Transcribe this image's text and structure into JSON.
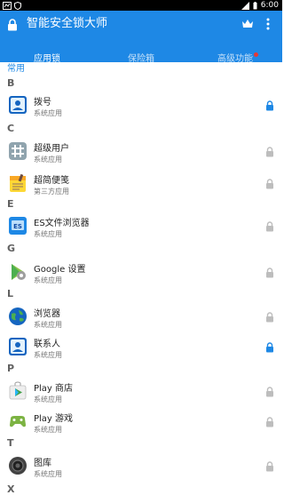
{
  "status": {
    "time": "6:00"
  },
  "header": {
    "title": "智能安全锁大师"
  },
  "tabs": [
    {
      "label": "应用锁",
      "active": true
    },
    {
      "label": "保险箱"
    },
    {
      "label": "高级功能",
      "badge": true
    }
  ],
  "list": {
    "partial_header": "常用",
    "sections": [
      {
        "letter": "B"
      },
      {
        "letter": "C"
      },
      {
        "letter": "E"
      },
      {
        "letter": "G"
      },
      {
        "letter": "L"
      },
      {
        "letter": "P"
      },
      {
        "letter": "T"
      },
      {
        "letter": "X"
      }
    ],
    "apps": [
      {
        "name": "拨号",
        "type": "系统应用",
        "icon": "dialer-icon",
        "locked": true
      },
      {
        "name": "超级用户",
        "type": "系统应用",
        "icon": "superuser-icon",
        "locked": false
      },
      {
        "name": "超简便笺",
        "type": "第三方应用",
        "icon": "notes-icon",
        "locked": false
      },
      {
        "name": "ES文件浏览器",
        "type": "系统应用",
        "icon": "es-file-explorer-icon",
        "locked": false
      },
      {
        "name": "Google 设置",
        "type": "系统应用",
        "icon": "google-settings-icon",
        "locked": false
      },
      {
        "name": "浏览器",
        "type": "系统应用",
        "icon": "browser-globe-icon",
        "locked": false
      },
      {
        "name": "联系人",
        "type": "系统应用",
        "icon": "contacts-icon",
        "locked": true
      },
      {
        "name": "Play 商店",
        "type": "系统应用",
        "icon": "play-store-icon",
        "locked": false
      },
      {
        "name": "Play 游戏",
        "type": "系统应用",
        "icon": "play-games-icon",
        "locked": false
      },
      {
        "name": "图库",
        "type": "系统应用",
        "icon": "gallery-camera-icon",
        "locked": false
      }
    ]
  },
  "colors": {
    "primary": "#1e88e5",
    "locked": "#1e88e5",
    "unlocked": "#bdbdbd",
    "badge": "#e53935"
  }
}
